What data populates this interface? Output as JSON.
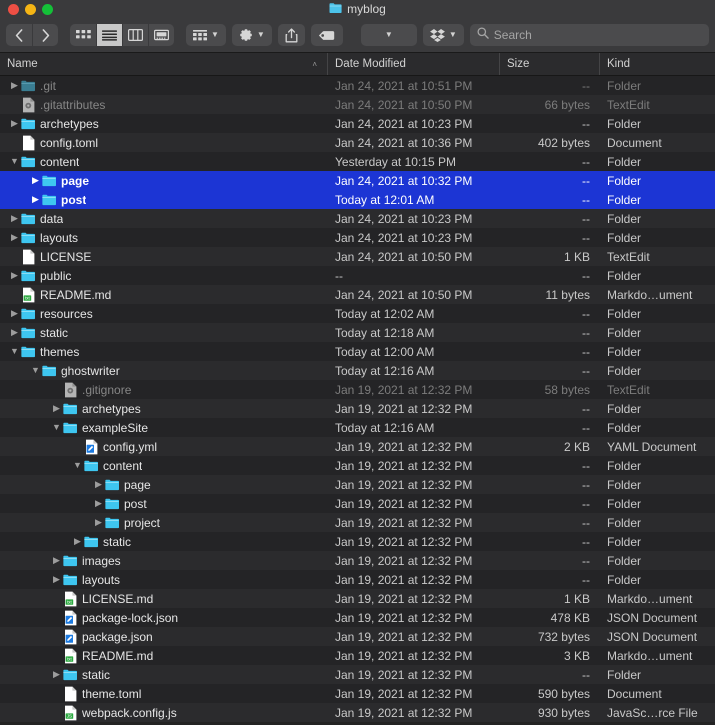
{
  "window": {
    "title": "myblog",
    "title_icon": "folder-icon",
    "traffic_lights": [
      {
        "name": "close",
        "color": "#ee4f44"
      },
      {
        "name": "minimize",
        "color": "#f5b515"
      },
      {
        "name": "maximize",
        "color": "#14c038"
      }
    ]
  },
  "toolbar": {
    "back_label": "‹",
    "forward_label": "›",
    "view_icon_label": "icon-view",
    "view_list_label": "list-view",
    "view_column_label": "column-view",
    "view_gallery_label": "gallery-view",
    "group_label": "group-by",
    "action_label": "action-gear",
    "share_label": "share",
    "tag_label": "tags",
    "dropdown_label": "",
    "dropbox_label": "dropbox"
  },
  "search": {
    "placeholder": "Search",
    "value": ""
  },
  "columns": [
    {
      "key": "name",
      "label": "Name",
      "sorted": true,
      "sort_caret": "˄"
    },
    {
      "key": "date",
      "label": "Date Modified"
    },
    {
      "key": "size",
      "label": "Size"
    },
    {
      "key": "kind",
      "label": "Kind"
    }
  ],
  "colors": {
    "selection": "#1c35d4",
    "folder": "#3ec6f0",
    "titlebar": "#3a3a3c",
    "row_odd": "#242426",
    "row_even": "#2b2b2d"
  },
  "files": [
    {
      "name": ".git",
      "indent": 0,
      "twisty": "collapsed",
      "icon": "folder-icon-dim",
      "date": "Jan 24, 2021 at 10:51 PM",
      "size": "--",
      "kind": "Folder",
      "dim": true,
      "selected": false
    },
    {
      "name": ".gitattributes",
      "indent": 0,
      "twisty": "none",
      "icon": "config-file-icon",
      "date": "Jan 24, 2021 at 10:50 PM",
      "size": "66 bytes",
      "kind": "TextEdit",
      "dim": true,
      "selected": false
    },
    {
      "name": "archetypes",
      "indent": 0,
      "twisty": "collapsed",
      "icon": "folder-icon",
      "date": "Jan 24, 2021 at 10:23 PM",
      "size": "--",
      "kind": "Folder",
      "dim": false,
      "selected": false
    },
    {
      "name": "config.toml",
      "indent": 0,
      "twisty": "none",
      "icon": "blank-doc-icon",
      "date": "Jan 24, 2021 at 10:36 PM",
      "size": "402 bytes",
      "kind": "Document",
      "dim": false,
      "selected": false
    },
    {
      "name": "content",
      "indent": 0,
      "twisty": "expanded",
      "icon": "folder-icon",
      "date": "Yesterday at 10:15 PM",
      "size": "--",
      "kind": "Folder",
      "dim": false,
      "selected": false
    },
    {
      "name": "page",
      "indent": 1,
      "twisty": "collapsed",
      "icon": "folder-icon",
      "date": "Jan 24, 2021 at 10:32 PM",
      "size": "--",
      "kind": "Folder",
      "dim": false,
      "selected": true
    },
    {
      "name": "post",
      "indent": 1,
      "twisty": "collapsed",
      "icon": "folder-icon",
      "date": "Today at 12:01 AM",
      "size": "--",
      "kind": "Folder",
      "dim": false,
      "selected": true
    },
    {
      "name": "data",
      "indent": 0,
      "twisty": "collapsed",
      "icon": "folder-icon",
      "date": "Jan 24, 2021 at 10:23 PM",
      "size": "--",
      "kind": "Folder",
      "dim": false,
      "selected": false
    },
    {
      "name": "layouts",
      "indent": 0,
      "twisty": "collapsed",
      "icon": "folder-icon",
      "date": "Jan 24, 2021 at 10:23 PM",
      "size": "--",
      "kind": "Folder",
      "dim": false,
      "selected": false
    },
    {
      "name": "LICENSE",
      "indent": 0,
      "twisty": "none",
      "icon": "blank-doc-icon",
      "date": "Jan 24, 2021 at 10:50 PM",
      "size": "1 KB",
      "kind": "TextEdit",
      "dim": false,
      "selected": false
    },
    {
      "name": "public",
      "indent": 0,
      "twisty": "collapsed",
      "icon": "folder-icon",
      "date": "--",
      "size": "--",
      "kind": "Folder",
      "dim": false,
      "selected": false
    },
    {
      "name": "README.md",
      "indent": 0,
      "twisty": "none",
      "icon": "txt-doc-icon",
      "date": "Jan 24, 2021 at 10:50 PM",
      "size": "11 bytes",
      "kind": "Markdo…ument",
      "dim": false,
      "selected": false
    },
    {
      "name": "resources",
      "indent": 0,
      "twisty": "collapsed",
      "icon": "folder-icon",
      "date": "Today at 12:02 AM",
      "size": "--",
      "kind": "Folder",
      "dim": false,
      "selected": false
    },
    {
      "name": "static",
      "indent": 0,
      "twisty": "collapsed",
      "icon": "folder-icon",
      "date": "Today at 12:18 AM",
      "size": "--",
      "kind": "Folder",
      "dim": false,
      "selected": false
    },
    {
      "name": "themes",
      "indent": 0,
      "twisty": "expanded",
      "icon": "folder-icon",
      "date": "Today at 12:00 AM",
      "size": "--",
      "kind": "Folder",
      "dim": false,
      "selected": false
    },
    {
      "name": "ghostwriter",
      "indent": 1,
      "twisty": "expanded",
      "icon": "folder-icon",
      "date": "Today at 12:16 AM",
      "size": "--",
      "kind": "Folder",
      "dim": false,
      "selected": false
    },
    {
      "name": ".gitignore",
      "indent": 2,
      "twisty": "none",
      "icon": "config-file-icon",
      "date": "Jan 19, 2021 at 12:32 PM",
      "size": "58 bytes",
      "kind": "TextEdit",
      "dim": true,
      "selected": false
    },
    {
      "name": "archetypes",
      "indent": 2,
      "twisty": "collapsed",
      "icon": "folder-icon",
      "date": "Jan 19, 2021 at 12:32 PM",
      "size": "--",
      "kind": "Folder",
      "dim": false,
      "selected": false
    },
    {
      "name": "exampleSite",
      "indent": 2,
      "twisty": "expanded",
      "icon": "folder-icon",
      "date": "Today at 12:16 AM",
      "size": "--",
      "kind": "Folder",
      "dim": false,
      "selected": false
    },
    {
      "name": "config.yml",
      "indent": 3,
      "twisty": "none",
      "icon": "code-doc-icon",
      "date": "Jan 19, 2021 at 12:32 PM",
      "size": "2 KB",
      "kind": "YAML Document",
      "dim": false,
      "selected": false
    },
    {
      "name": "content",
      "indent": 3,
      "twisty": "expanded",
      "icon": "folder-icon",
      "date": "Jan 19, 2021 at 12:32 PM",
      "size": "--",
      "kind": "Folder",
      "dim": false,
      "selected": false
    },
    {
      "name": "page",
      "indent": 4,
      "twisty": "collapsed",
      "icon": "folder-icon",
      "date": "Jan 19, 2021 at 12:32 PM",
      "size": "--",
      "kind": "Folder",
      "dim": false,
      "selected": false
    },
    {
      "name": "post",
      "indent": 4,
      "twisty": "collapsed",
      "icon": "folder-icon",
      "date": "Jan 19, 2021 at 12:32 PM",
      "size": "--",
      "kind": "Folder",
      "dim": false,
      "selected": false
    },
    {
      "name": "project",
      "indent": 4,
      "twisty": "collapsed",
      "icon": "folder-icon",
      "date": "Jan 19, 2021 at 12:32 PM",
      "size": "--",
      "kind": "Folder",
      "dim": false,
      "selected": false
    },
    {
      "name": "static",
      "indent": 3,
      "twisty": "collapsed",
      "icon": "folder-icon",
      "date": "Jan 19, 2021 at 12:32 PM",
      "size": "--",
      "kind": "Folder",
      "dim": false,
      "selected": false
    },
    {
      "name": "images",
      "indent": 2,
      "twisty": "collapsed",
      "icon": "folder-icon",
      "date": "Jan 19, 2021 at 12:32 PM",
      "size": "--",
      "kind": "Folder",
      "dim": false,
      "selected": false
    },
    {
      "name": "layouts",
      "indent": 2,
      "twisty": "collapsed",
      "icon": "folder-icon",
      "date": "Jan 19, 2021 at 12:32 PM",
      "size": "--",
      "kind": "Folder",
      "dim": false,
      "selected": false
    },
    {
      "name": "LICENSE.md",
      "indent": 2,
      "twisty": "none",
      "icon": "txt-doc-icon",
      "date": "Jan 19, 2021 at 12:32 PM",
      "size": "1 KB",
      "kind": "Markdo…ument",
      "dim": false,
      "selected": false
    },
    {
      "name": "package-lock.json",
      "indent": 2,
      "twisty": "none",
      "icon": "code-doc-icon",
      "date": "Jan 19, 2021 at 12:32 PM",
      "size": "478 KB",
      "kind": "JSON Document",
      "dim": false,
      "selected": false
    },
    {
      "name": "package.json",
      "indent": 2,
      "twisty": "none",
      "icon": "code-doc-icon",
      "date": "Jan 19, 2021 at 12:32 PM",
      "size": "732 bytes",
      "kind": "JSON Document",
      "dim": false,
      "selected": false
    },
    {
      "name": "README.md",
      "indent": 2,
      "twisty": "none",
      "icon": "txt-doc-icon",
      "date": "Jan 19, 2021 at 12:32 PM",
      "size": "3 KB",
      "kind": "Markdo…ument",
      "dim": false,
      "selected": false
    },
    {
      "name": "static",
      "indent": 2,
      "twisty": "collapsed",
      "icon": "folder-icon",
      "date": "Jan 19, 2021 at 12:32 PM",
      "size": "--",
      "kind": "Folder",
      "dim": false,
      "selected": false
    },
    {
      "name": "theme.toml",
      "indent": 2,
      "twisty": "none",
      "icon": "blank-doc-icon",
      "date": "Jan 19, 2021 at 12:32 PM",
      "size": "590 bytes",
      "kind": "Document",
      "dim": false,
      "selected": false
    },
    {
      "name": "webpack.config.js",
      "indent": 2,
      "twisty": "none",
      "icon": "js-doc-icon",
      "date": "Jan 19, 2021 at 12:32 PM",
      "size": "930 bytes",
      "kind": "JavaSc…rce File",
      "dim": false,
      "selected": false
    }
  ]
}
